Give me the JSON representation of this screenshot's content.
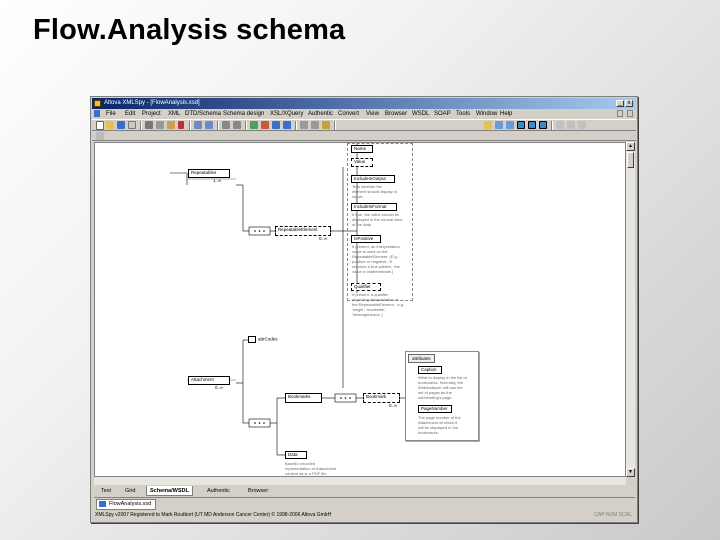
{
  "slide": {
    "title": "Flow.Analysis schema"
  },
  "app": {
    "title": "Altova XMLSpy - [FlowAnalysis.xsd]",
    "menu": [
      "File",
      "Edit",
      "Project",
      "XML",
      "DTD/Schema",
      "Schema design",
      "XSL/XQuery",
      "Authentic",
      "Convert",
      "View",
      "Browser",
      "WSDL",
      "SOAP",
      "Tools",
      "Window",
      "Help"
    ]
  },
  "diagram": {
    "repeatables": "Repeatables",
    "repeatables_card": "1..∞",
    "repeatable_element": "RepeatableElement",
    "repeatable_card": "0..∞",
    "name": "Name",
    "value": "Value",
    "include_in_output": "IncludeInOutput",
    "include_in_output_desc": "Tells whether the\nelement should display in\nreport.",
    "include_in_format": "IncludeInFormat",
    "include_in_format_desc": "If true, the value should be\ndisplayed in the normal view\nof the data",
    "is_positive": "IsPositive",
    "is_positive_desc": "If present, an interpretation\nvalue is used on the\nRepeatableElement. (E.g.:\npositive or negative, 'If'\nrequires a true pattern, 'the\nvalue is indeterminate.)",
    "qualifier": "Qualifier",
    "qualifier_desc": "If present, a qualifier\nregarding interpretation of\nthe RepeatableElement - e.g.\n'single', 'moderate',\n'heterogeneous'.)",
    "attr_codes": "attrCodes",
    "attachment": "Attachment",
    "attachment_card": "0..∞",
    "bookmarks": "Bookmarks",
    "bookmark": "Bookmark",
    "bookmark_card": "0..∞",
    "attributes_label": "attributes",
    "caption": "Caption",
    "caption_desc": "What to display in the list of\nbookmarks. Normally, the\nWebAnalyzer will use the\nset of pages as the\nsubheading's page.",
    "page_number": "PageNumber",
    "page_number_desc": "The page number of the\nAttachment at which it\nwill be displayed in the\nbookmarks.",
    "data": "Data",
    "data_desc": "Base64 encoded\nrepresentation of Attachment\ncontent as in a PDF file."
  },
  "view_tabs": {
    "text": "Text",
    "grid": "Grid",
    "schema": "Schema/WSDL",
    "authentic": "Authentic",
    "browser": "Browser"
  },
  "file_tab": "FlowAnalysis.xsd",
  "status": {
    "left": "XMLSpy v2007   Registered to Mark Routbort (UT MD Anderson Cancer Center)   © 1998-2006 Altova GmbH",
    "right": "CAP  NUM  SCRL"
  },
  "colors": {
    "titlebar_start": "#0a246a",
    "titlebar_end": "#a6caf0",
    "chrome": "#d4d0c8"
  }
}
